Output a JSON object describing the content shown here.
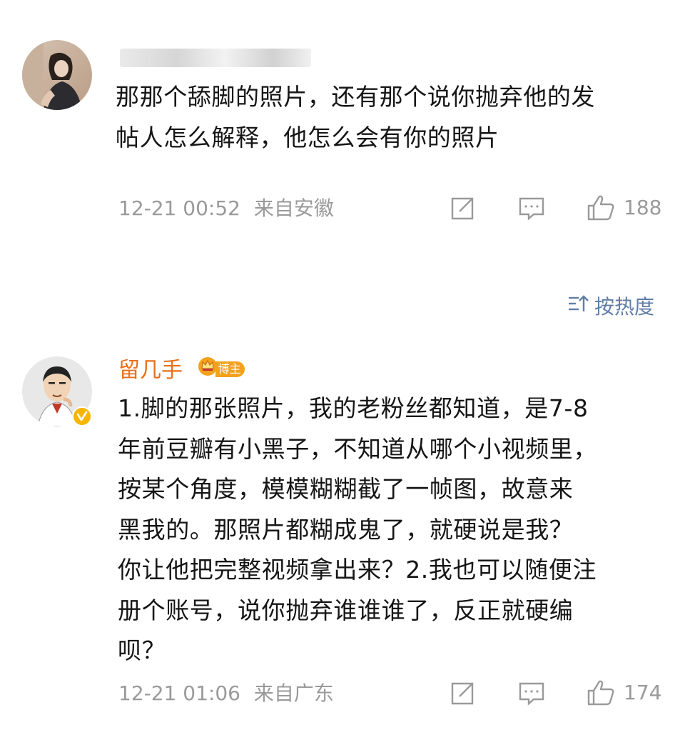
{
  "comments": [
    {
      "username": "",
      "text_lines": [
        "那那个舔脚的照片，还有那个说你抛弃他的发",
        "帖人怎么解释，他怎么会有你的照片"
      ],
      "timestamp": "12-21 00:52",
      "location": "来自安徽",
      "likes": "188",
      "share_icon": "share-icon",
      "reply_icon": "comment-icon",
      "like_icon": "thumbs-up-icon"
    },
    {
      "username": "留几手",
      "badge": "博主",
      "text_lines": [
        "1.脚的那张照片，我的老粉丝都知道，是7-8",
        "年前豆瓣有小黑子，不知道从哪个小视频里，",
        "按某个角度，模模糊糊截了一帧图，故意来",
        "黑我的。那照片都糊成鬼了，就硬说是我？",
        "你让他把完整视频拿出来？2.我也可以随便注",
        "册个账号，说你抛弃谁谁谁了，反正就硬编",
        "呗？"
      ],
      "timestamp": "12-21 01:06",
      "location": "来自广东",
      "likes": "174",
      "share_icon": "share-icon",
      "reply_icon": "comment-icon",
      "like_icon": "thumbs-up-icon"
    }
  ],
  "sort": {
    "label": "按热度",
    "icon": "sort-icon"
  },
  "colors": {
    "username_orange": "#e8701a",
    "meta_gray": "#9a9a9a",
    "sort_blue": "#5f7ea6",
    "badge_gold": "#f4a11d",
    "verified_yellow": "#f7b500"
  }
}
